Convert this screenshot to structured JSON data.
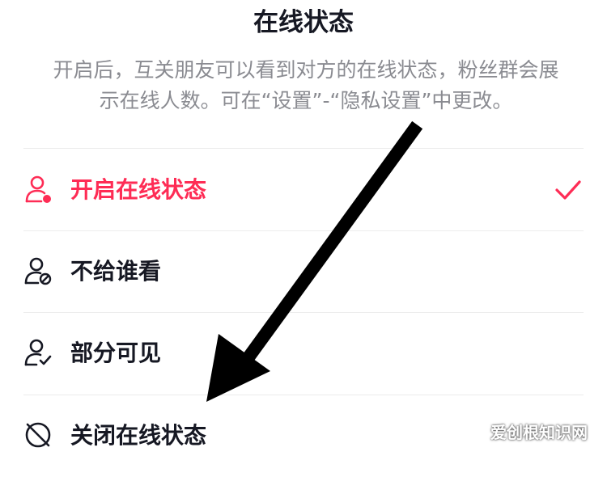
{
  "page": {
    "title": "在线状态",
    "description_line1": "开启后，互关朋友可以看到对方的在线状态，粉丝群会展",
    "description_line2": "示在线人数。可在“设置”-“隐私设置”中更改。"
  },
  "options": [
    {
      "label": "开启在线状态",
      "icon": "user-online-icon",
      "selected": true
    },
    {
      "label": "不给谁看",
      "icon": "user-block-icon",
      "selected": false
    },
    {
      "label": "部分可见",
      "icon": "user-check-icon",
      "selected": false
    },
    {
      "label": "关闭在线状态",
      "icon": "offline-icon",
      "selected": false
    }
  ],
  "colors": {
    "accent": "#fe2c55",
    "text": "#161823",
    "secondary_text": "#8a8b91",
    "divider": "#ececec",
    "annotation_arrow": "#000000"
  },
  "watermark": {
    "text": "爱创根知识网"
  }
}
